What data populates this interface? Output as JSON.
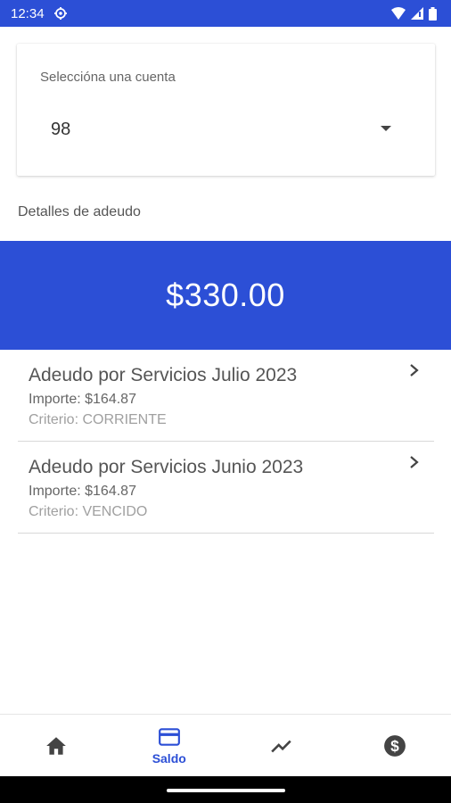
{
  "status_bar": {
    "time": "12:34"
  },
  "account_selector": {
    "label": "Seleccióna una cuenta",
    "value": "98"
  },
  "section": {
    "title": "Detalles de adeudo"
  },
  "total": {
    "amount": "$330.00"
  },
  "debts": [
    {
      "title": "Adeudo por Servicios Julio 2023",
      "amount": "Importe: $164.87",
      "criteria": "Criterio: CORRIENTE"
    },
    {
      "title": "Adeudo por Servicios Junio 2023",
      "amount": "Importe: $164.87",
      "criteria": "Criterio: VENCIDO"
    }
  ],
  "bottom_nav": {
    "items": [
      {
        "icon": "home-icon",
        "label": ""
      },
      {
        "icon": "card-icon",
        "label": "Saldo"
      },
      {
        "icon": "trending-icon",
        "label": ""
      },
      {
        "icon": "dollar-icon",
        "label": ""
      }
    ],
    "active_index": 1
  },
  "colors": {
    "primary": "#2c4fd6"
  }
}
